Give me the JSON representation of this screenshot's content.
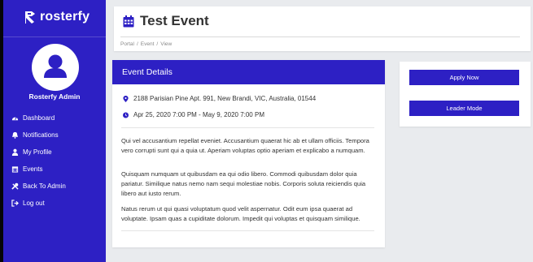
{
  "colors": {
    "primary": "#2d20c4",
    "background": "#e9ebee",
    "card": "#ffffff"
  },
  "brand": {
    "name": "rosterfy",
    "icon": "rosterfy-logo-icon"
  },
  "user": {
    "name": "Rosterfy Admin",
    "avatar_icon": "user-silhouette-icon"
  },
  "sidebar": {
    "items": [
      {
        "label": "Dashboard",
        "icon": "tachometer-icon"
      },
      {
        "label": "Notifications",
        "icon": "bell-icon"
      },
      {
        "label": "My Profile",
        "icon": "user-icon"
      },
      {
        "label": "Events",
        "icon": "calendar-icon"
      },
      {
        "label": "Back To Admin",
        "icon": "tools-icon"
      },
      {
        "label": "Log out",
        "icon": "sign-out-icon"
      }
    ]
  },
  "header": {
    "title": "Test Event",
    "icon": "calendar-icon",
    "breadcrumb": [
      "Portal",
      "Event",
      "View"
    ]
  },
  "details": {
    "heading": "Event Details",
    "address": "2188 Parisian Pine Apt. 991, New Brandi, VIC, Australia, 01544",
    "address_icon": "map-marker-icon",
    "date_range": "Apr 25, 2020 7:00 PM - May 9, 2020 7:00 PM",
    "date_icon": "clock-icon",
    "paragraphs": [
      "Qui vel accusantium repellat eveniet. Accusantium quaerat hic ab et ullam officiis. Tempora vero corrupti sunt qui a quia ut. Aperiam voluptas optio aperiam et explicabo a numquam.",
      "Quisquam numquam ut quibusdam ea qui odio libero. Commodi quibusdam dolor quia pariatur. Similique natus nemo nam sequi molestiae nobis. Corporis soluta reiciendis quia libero aut iusto rerum.",
      "Natus rerum ut qui quasi voluptatum quod velit aspernatur. Odit eum ipsa quaerat ad voluptate. Ipsam quas a cupiditate dolorum. Impedit qui voluptas et quisquam similique."
    ]
  },
  "actions": {
    "apply_label": "Apply Now",
    "leader_label": "Leader Mode"
  }
}
